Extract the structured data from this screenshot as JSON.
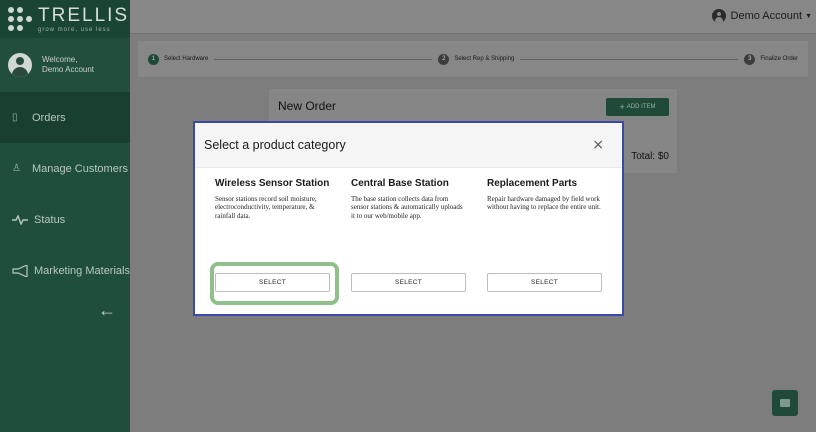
{
  "sidebar": {
    "logo": {
      "name": "TRELLIS",
      "tagline": "grow more, use less"
    },
    "welcome": {
      "line1": "Welcome,",
      "line2": "Demo Account"
    },
    "items": [
      {
        "label": "Orders",
        "icon": "document-icon",
        "active": true
      },
      {
        "label": "Manage Customers",
        "icon": "person-icon",
        "active": false
      },
      {
        "label": "Status",
        "icon": "pulse-icon",
        "active": false
      },
      {
        "label": "Marketing Materials",
        "icon": "megaphone-icon",
        "active": false
      }
    ],
    "collapse_icon": "arrow-left-icon"
  },
  "topbar": {
    "account_label": "Demo Account"
  },
  "stepper": {
    "steps": [
      {
        "num": "1",
        "label": "Select Hardware"
      },
      {
        "num": "2",
        "label": "Select Rep & Shipping"
      },
      {
        "num": "3",
        "label": "Finalize Order"
      }
    ]
  },
  "order": {
    "title": "New Order",
    "add_item_label": "ADD ITEM",
    "total": "Total: $0"
  },
  "modal": {
    "title": "Select a product category",
    "close_glyph": "×",
    "categories": [
      {
        "title": "Wireless Sensor Station",
        "description": "Sensor stations record soil moisture, electroconductivity, temperature, & rainfall data.",
        "button": "SELECT"
      },
      {
        "title": "Central Base Station",
        "description": "The base station collects data from sensor stations & automatically uploads it to our web/mobile app.",
        "button": "SELECT"
      },
      {
        "title": "Replacement Parts",
        "description": "Repair hardware damaged by field work without having to replace the entire unit.",
        "button": "SELECT"
      }
    ]
  },
  "colors": {
    "brand_green": "#1e4a37",
    "modal_border": "#3c48a8",
    "highlight": "#8fc08c"
  }
}
